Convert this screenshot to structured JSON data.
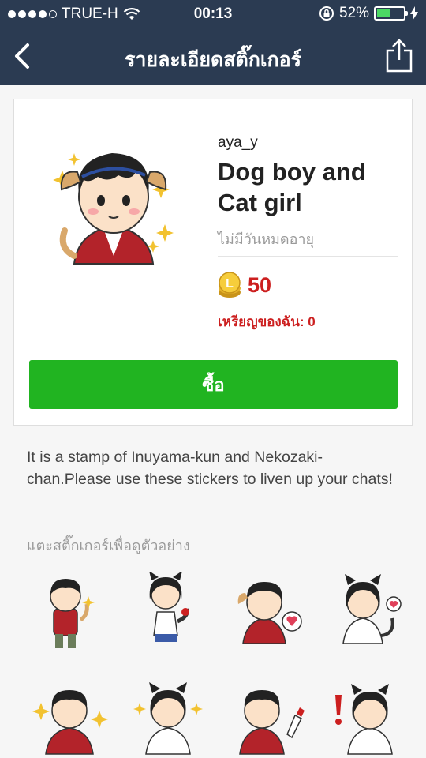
{
  "status": {
    "carrier": "TRUE-H",
    "time": "00:13",
    "battery": "52%",
    "battery_level": 0.52,
    "icons": [
      "signal-dots-icon",
      "wifi-icon",
      "rotation-lock-icon",
      "battery-icon",
      "charging-icon"
    ]
  },
  "nav": {
    "title": "รายละเอียดสติ๊กเกอร์",
    "back_icon": "chevron-left-icon",
    "share_icon": "share-icon"
  },
  "sticker": {
    "author": "aya_y",
    "name": "Dog boy and Cat girl",
    "validity": "ไม่มีวันหมดอายุ",
    "price": "50",
    "my_coins_label": "เหรียญของฉัน: 0",
    "buy_label": "ซื้อ",
    "coin_icon": "coin-icon"
  },
  "description": "It is a stamp of Inuyama-kun and Nekozaki-chan.Please  use these stickers to liven up your chats!",
  "preview_hint": "แตะสติ๊กเกอร์เพื่อดูตัวอย่าง",
  "colors": {
    "nav_bg": "#2b3b52",
    "buy_green": "#21b421",
    "price_red": "#cc1f1f"
  }
}
